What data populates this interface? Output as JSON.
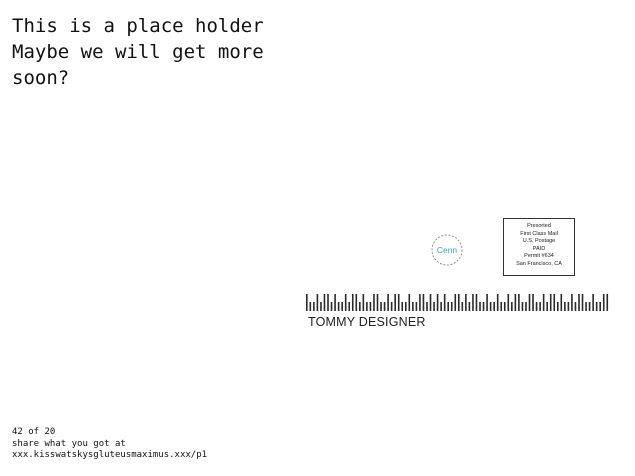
{
  "headline": {
    "line1": "This is a place holder",
    "line2": "Maybe we will get more",
    "line3": "soon?"
  },
  "stamp_logo": {
    "text": "Cenn",
    "accent": "#3a9ad9"
  },
  "postage": {
    "line1": "Presorted",
    "line2": "First Class Mail",
    "line3": "U.S. Postage",
    "line4": "PAID",
    "line5": "Permit #634",
    "line6": "San Francisco, CA"
  },
  "recipient_name": "TOMMY DESIGNER",
  "footer": {
    "page_count": "42 of 20",
    "share_text": "share what you got at",
    "url": "xxx.kisswatskysgluteusmaximus.xxx/p1"
  },
  "colors": {
    "ink": "#111111",
    "barcode": "#2a2a2a"
  }
}
